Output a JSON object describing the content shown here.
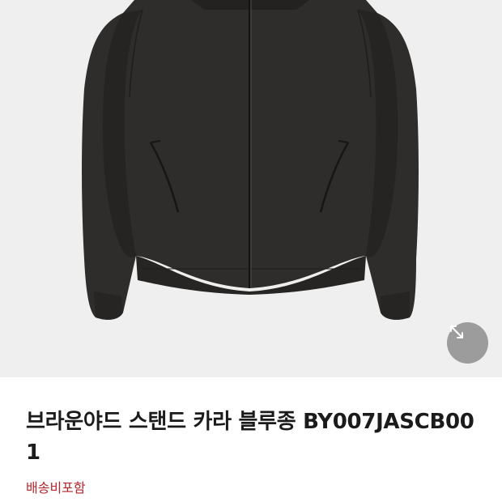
{
  "product": {
    "image_alt": "dark charcoal stand collar blouson jacket",
    "title": "브라운야드 스탠드 카라 블루종 BY007JASCB001",
    "shipping": "배송비포함"
  },
  "icons": {
    "zoom": "expand-arrows-icon"
  },
  "colors": {
    "image_background": "#efefef",
    "jacket": "#2e2d2b",
    "zoom_button": "#9c9c9c",
    "shipping_text": "#b3262c"
  }
}
